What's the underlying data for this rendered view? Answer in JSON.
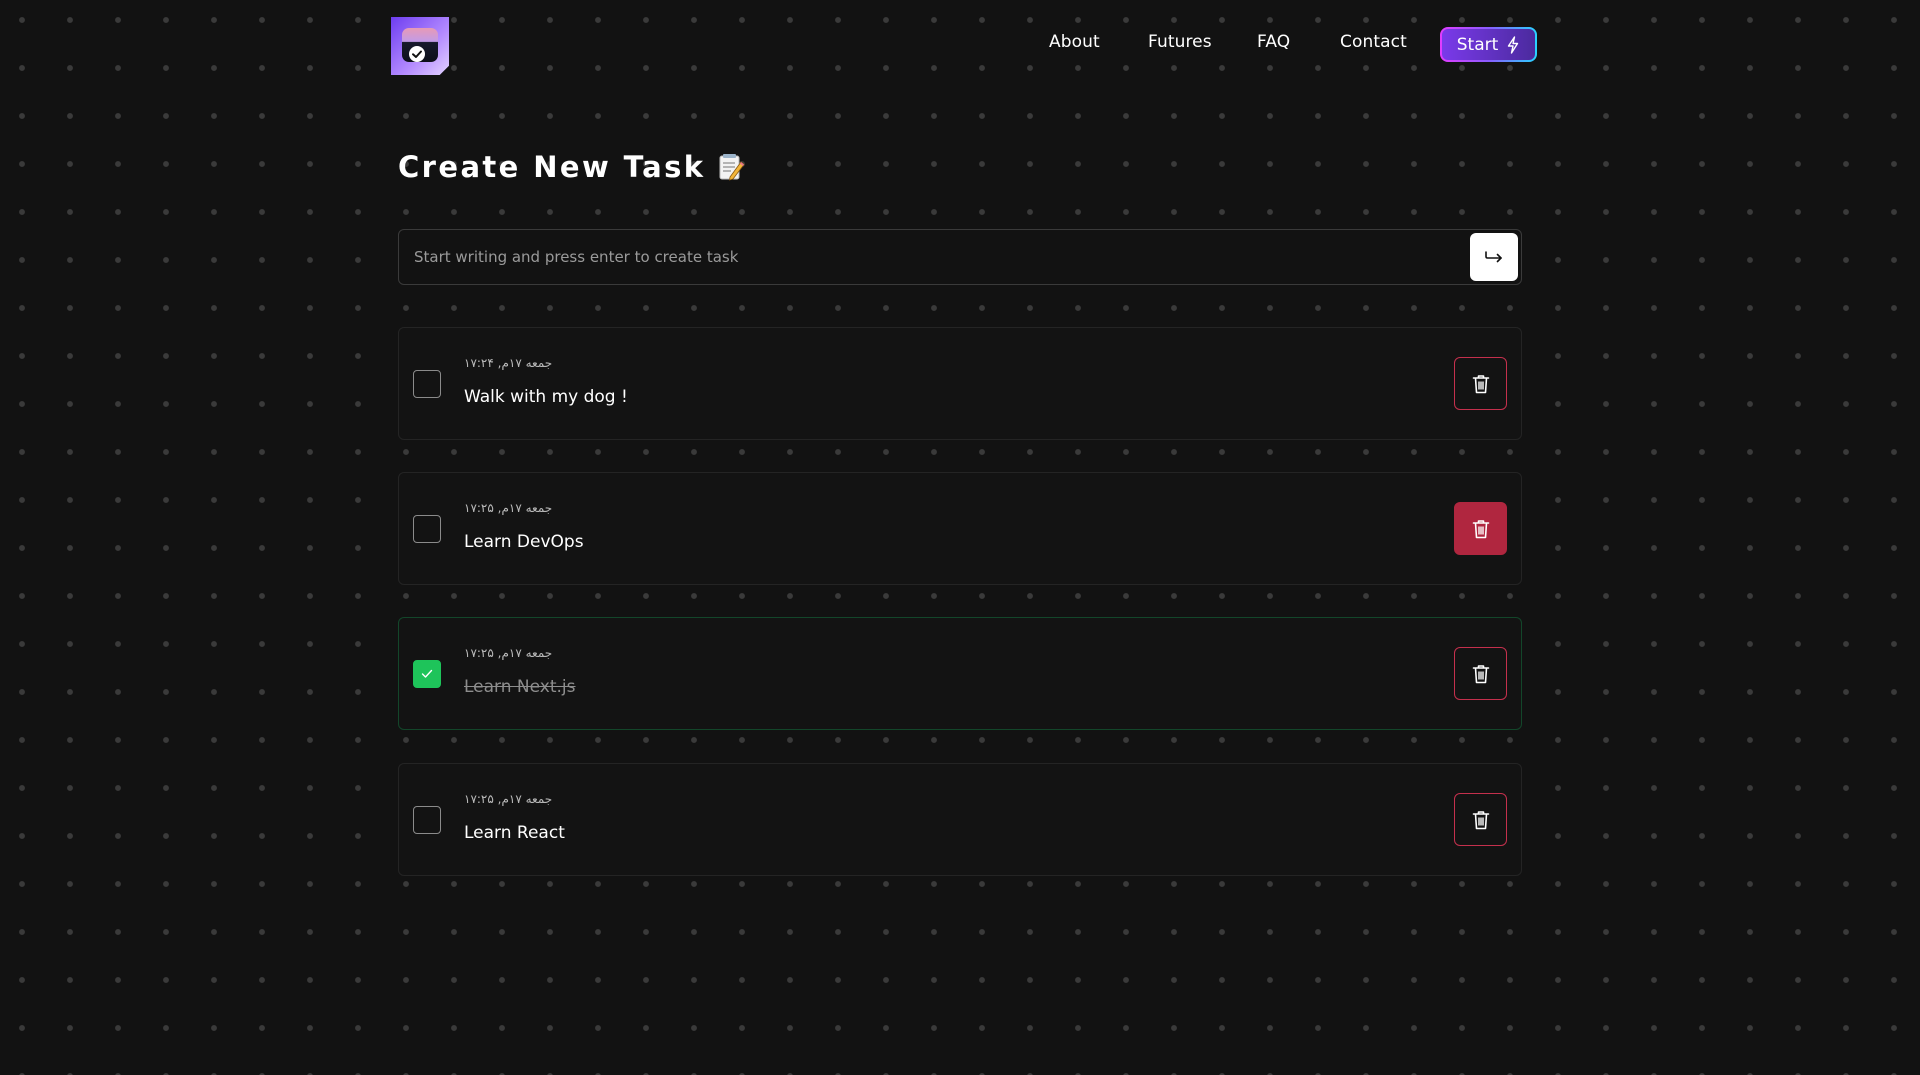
{
  "brand": {
    "logo_icon": "task-check-logo-icon"
  },
  "nav": {
    "items": [
      "About",
      "Futures",
      "FAQ",
      "Contact"
    ],
    "start_label": "Start",
    "start_icon": "lightning-bolt-icon"
  },
  "page": {
    "title": "Create New Task",
    "title_icon": "memo-pencil-icon"
  },
  "task_input": {
    "placeholder": "Start writing and press enter to create task",
    "value": "",
    "submit_icon": "enter-arrow-icon"
  },
  "tasks": [
    {
      "date": "جمعه ۱۷م, ۱۷:۲۴",
      "title": "Walk with my dog !",
      "completed": false
    },
    {
      "date": "جمعه ۱۷م, ۱۷:۲۵",
      "title": "Learn DevOps",
      "completed": false
    },
    {
      "date": "جمعه ۱۷م, ۱۷:۲۵",
      "title": "Learn Next.js",
      "completed": true
    },
    {
      "date": "جمعه ۱۷م, ۱۷:۲۵",
      "title": "Learn React",
      "completed": false
    }
  ],
  "colors": {
    "background": "#121212",
    "accent_purple": "#7a3aea",
    "done_green": "#1ec45a",
    "delete_red": "#c5304d"
  }
}
